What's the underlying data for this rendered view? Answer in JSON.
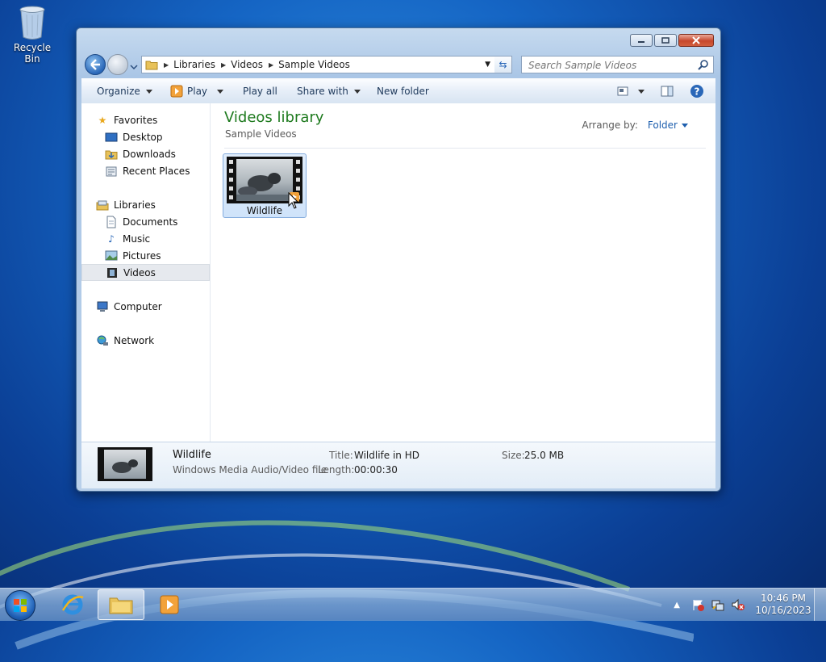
{
  "desktop": {
    "recycle_bin_label": "Recycle Bin"
  },
  "window": {
    "address": {
      "segments": [
        "Libraries",
        "Videos",
        "Sample Videos"
      ]
    },
    "search": {
      "placeholder": "Search Sample Videos"
    },
    "toolbar": {
      "organize": "Organize",
      "play": "Play",
      "play_all": "Play all",
      "share_with": "Share with",
      "new_folder": "New folder"
    },
    "nav": {
      "favorites": "Favorites",
      "desktop": "Desktop",
      "downloads": "Downloads",
      "recent_places": "Recent Places",
      "libraries": "Libraries",
      "documents": "Documents",
      "music": "Music",
      "pictures": "Pictures",
      "videos": "Videos",
      "computer": "Computer",
      "network": "Network"
    },
    "library": {
      "title": "Videos library",
      "subtitle": "Sample Videos",
      "arrange_label": "Arrange by:",
      "arrange_value": "Folder"
    },
    "files": [
      {
        "name": "Wildlife"
      }
    ],
    "details": {
      "name": "Wildlife",
      "type": "Windows Media Audio/Video file",
      "title_label": "Title:",
      "title_value": "Wildlife in HD",
      "length_label": "Length:",
      "length_value": "00:00:30",
      "size_label": "Size:",
      "size_value": "25.0 MB"
    }
  },
  "taskbar": {
    "time": "10:46 PM",
    "date": "10/16/2023"
  },
  "colors": {
    "library_title": "#1e7a1e",
    "link": "#1e5fae",
    "close_button": "#c7472c"
  }
}
